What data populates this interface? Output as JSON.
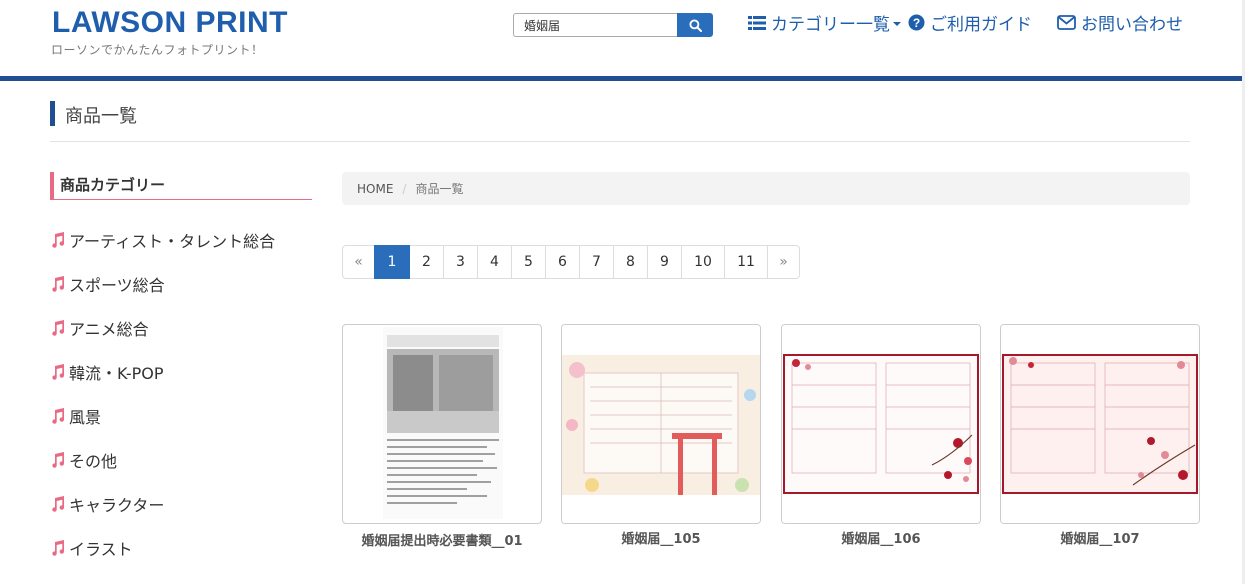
{
  "header": {
    "logo": "LAWSON PRINT",
    "tagline": "ローソンでかんたんフォトプリント！",
    "search": {
      "value": "婚姻届"
    },
    "nav": {
      "category": "カテゴリー一覧",
      "guide": "ご利用ガイド",
      "contact": "お問い合わせ"
    }
  },
  "page": {
    "title": "商品一覧"
  },
  "sidebar": {
    "heading": "商品カテゴリー",
    "items": [
      "アーティスト・タレント総合",
      "スポーツ総合",
      "アニメ総合",
      "韓流・K-POP",
      "風景",
      "その他",
      "キャラクター",
      "イラスト"
    ]
  },
  "breadcrumb": {
    "home": "HOME",
    "sep": "/",
    "current": "商品一覧"
  },
  "pagination": {
    "prev": "«",
    "pages": [
      "1",
      "2",
      "3",
      "4",
      "5",
      "6",
      "7",
      "8",
      "9",
      "10",
      "11"
    ],
    "next": "»",
    "active": "1"
  },
  "products": [
    {
      "name": "婚姻届提出時必要書類__01"
    },
    {
      "name": "婚姻届__105"
    },
    {
      "name": "婚姻届__106"
    },
    {
      "name": "婚姻届__107"
    }
  ],
  "colors": {
    "brand": "#1e5eac",
    "accent": "#2a6ebb",
    "sidebar_accent": "#e86a84",
    "header_bar": "#1f4e91"
  }
}
